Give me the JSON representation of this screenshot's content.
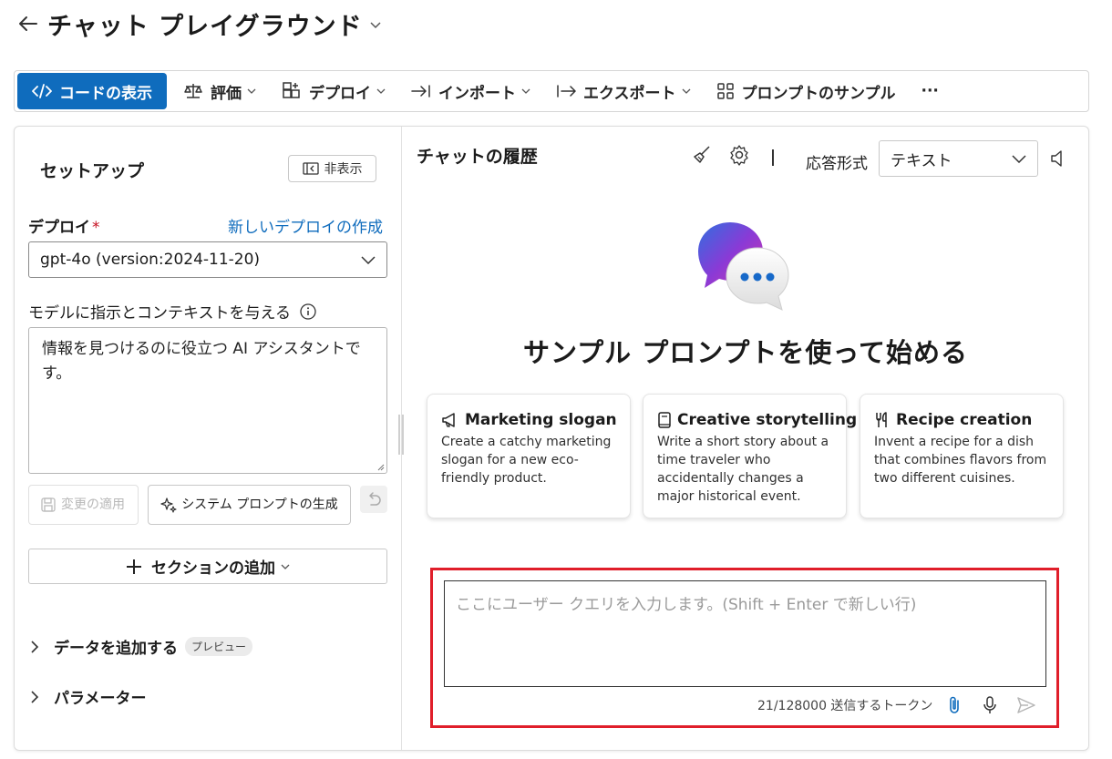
{
  "header": {
    "title": "チャット プレイグラウンド"
  },
  "toolbar": {
    "code_label": "コードの表示",
    "evaluate_label": "評価",
    "deploy_label": "デプロイ",
    "import_label": "インポート",
    "export_label": "エクスポート",
    "samples_label": "プロンプトのサンプル",
    "more_label": "···"
  },
  "setup": {
    "title": "セットアップ",
    "hide_label": "非表示",
    "deploy_label": "デプロイ",
    "required_mark": "*",
    "new_deploy_link": "新しいデプロイの作成",
    "model_value": "gpt-4o (version:2024-11-20)",
    "instructions_label": "モデルに指示とコンテキストを与える",
    "system_message": "情報を見つけるのに役立つ AI アシスタントです。",
    "apply_label": "変更の適用",
    "generate_label": "システム プロンプトの生成",
    "add_section_label": "セクションの追加",
    "add_data_label": "データを追加する",
    "preview_badge": "プレビュー",
    "parameters_label": "パラメーター"
  },
  "chat": {
    "history_title": "チャットの履歴",
    "response_format_label": "応答形式",
    "response_format_value": "テキスト",
    "sample_heading": "サンプル プロンプトを使って始める",
    "cards": [
      {
        "title": "Marketing slogan",
        "icon": "megaphone-icon",
        "description": "Create a catchy marketing slogan for a new eco-friendly product."
      },
      {
        "title": "Creative storytelling",
        "icon": "book-icon",
        "description": "Write a short story about a time traveler who accidentally changes a major historical event."
      },
      {
        "title": "Recipe creation",
        "icon": "utensils-icon",
        "description": "Invent a recipe for a dish that combines flavors from two different cuisines."
      }
    ],
    "input_placeholder": "ここにユーザー クエリを入力します。(Shift + Enter で新しい行)",
    "token_count": "21/128000 送信するトークン"
  },
  "colors": {
    "accent": "#0f6cbd",
    "highlight": "#e01e2a",
    "required": "#c50f1f"
  }
}
